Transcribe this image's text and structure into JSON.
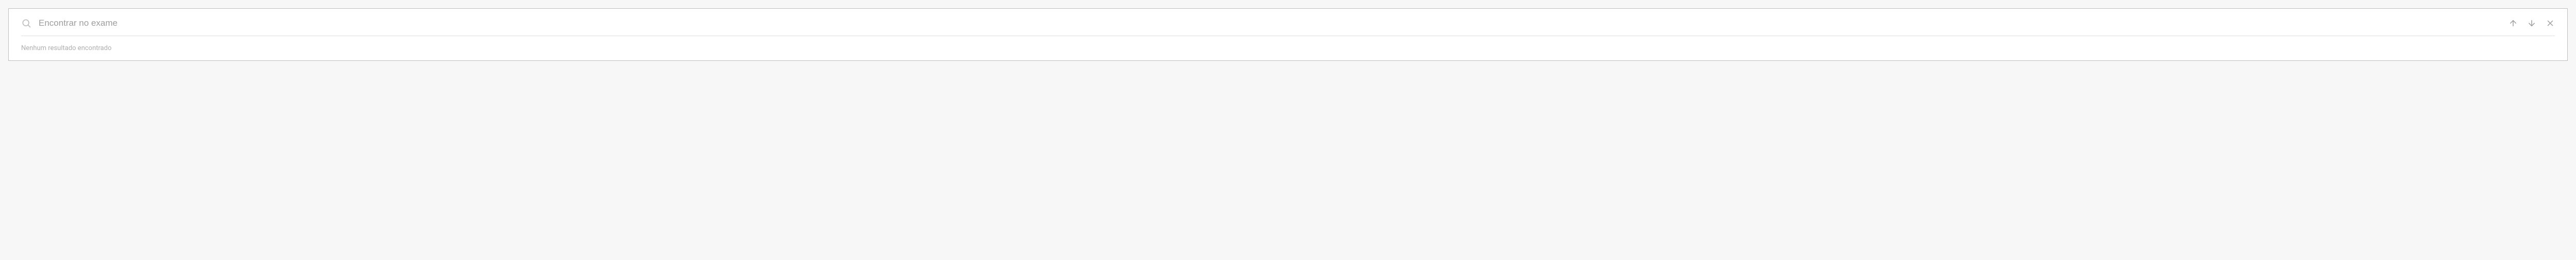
{
  "search": {
    "placeholder": "Encontrar no exame",
    "value": ""
  },
  "status": {
    "no_results": "Nenhum resultado encontrado"
  }
}
